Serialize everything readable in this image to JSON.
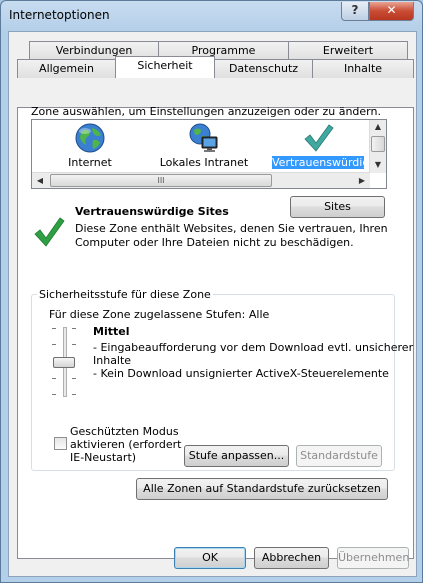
{
  "window": {
    "title": "Internetoptionen",
    "help_label": "?",
    "close_label": "✕"
  },
  "tabs": {
    "row1": [
      "Verbindungen",
      "Programme",
      "Erweitert"
    ],
    "row2": [
      "Allgemein",
      "Sicherheit",
      "Datenschutz",
      "Inhalte"
    ],
    "active": "Sicherheit"
  },
  "zones": {
    "instruction": "Zone auswählen, um Einstellungen anzuzeigen oder zu ändern.",
    "items": [
      {
        "label": "Internet",
        "icon": "globe-icon"
      },
      {
        "label": "Lokales Intranet",
        "icon": "intranet-icon"
      },
      {
        "label": "Vertrauenswürdige",
        "icon": "checkmark-icon",
        "selected": true
      }
    ],
    "hscroll_grip": "III"
  },
  "zone_info": {
    "title": "Vertrauenswürdige Sites",
    "description_line1": "Diese Zone enthält Websites, denen Sie vertrauen, Ihren",
    "description_line2": "Computer oder Ihre Dateien nicht zu beschädigen.",
    "sites_button": "Sites"
  },
  "security_level": {
    "group_label": "Sicherheitsstufe für diese Zone",
    "allowed_label": "Für diese Zone zugelassene Stufen: Alle",
    "level_name": "Mittel",
    "desc_line1": "- Eingabeaufforderung vor dem Download evtl. unsicherer",
    "desc_line2": "Inhalte",
    "desc_line3": "- Kein Download unsignierter ActiveX-Steuerelemente",
    "protected_mode_line1": "Geschützten Modus",
    "protected_mode_line2": "aktivieren (erfordert",
    "protected_mode_line3": "IE-Neustart)",
    "protected_mode_checked": false,
    "custom_button": "Stufe anpassen...",
    "default_button": "Standardstufe"
  },
  "reset_all_button": "Alle Zonen auf Standardstufe zurücksetzen",
  "footer": {
    "ok": "OK",
    "cancel": "Abbrechen",
    "apply": "Übernehmen"
  },
  "colors": {
    "selection": "#3399ff",
    "check_green": "#2ea043",
    "teal_check": "#3fa8a0"
  }
}
